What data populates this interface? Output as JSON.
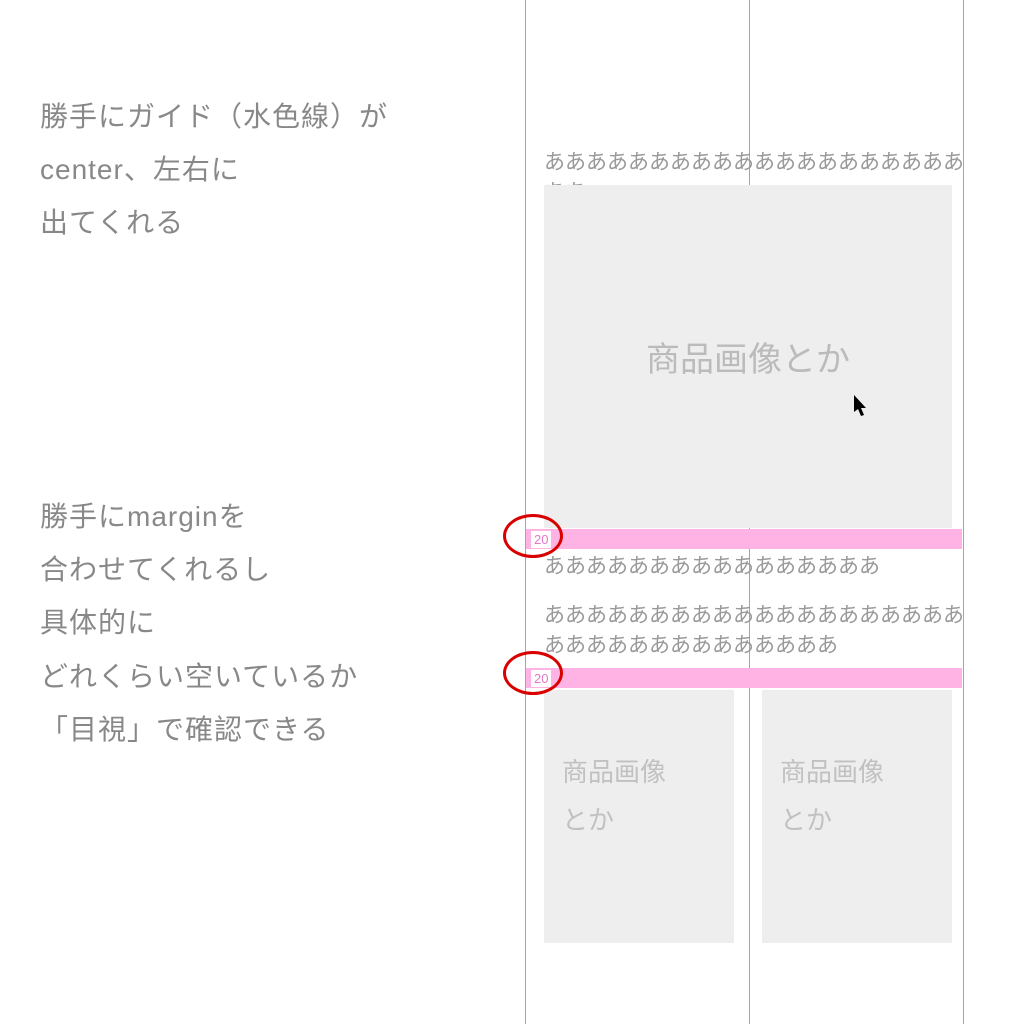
{
  "annotations": {
    "top": "勝手にガイド（水色線）が\ncenter、左右に\n出てくれる",
    "bottom": "勝手にmarginを\n合わせてくれるし\n具体的に\nどれくらい空いているか\n「目視」で確認できる"
  },
  "placeholders": {
    "large": "商品画像とか",
    "small_left": "商品画像\nとか",
    "small_right": "商品画像\nとか"
  },
  "filler": {
    "row1": "ああああああああああああああああああああああ",
    "row2": "ああああああああああああああああ",
    "row3": "ああああああああああああああああああああああああああああああああああ"
  },
  "margins": {
    "value1": "20",
    "value2": "20"
  },
  "colors": {
    "guide": "#1be0e0",
    "margin_bar": "#ffb3e5",
    "margin_text": "#e678c9",
    "circle": "#d90000",
    "annotation": "#888888",
    "placeholder_bg": "#eeeeee"
  }
}
